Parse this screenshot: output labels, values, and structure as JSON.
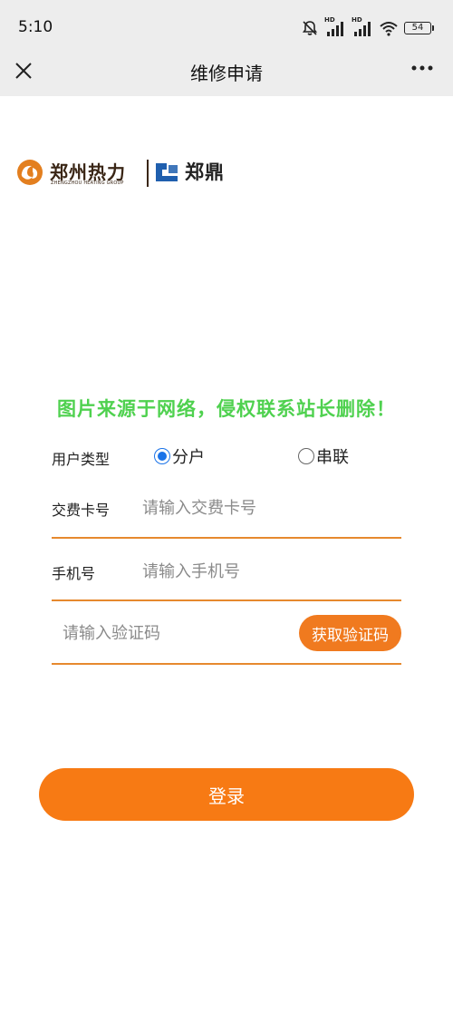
{
  "status_bar": {
    "time": "5:10",
    "hd_label": "HD",
    "battery": "54",
    "icons": [
      "bell-muted-icon",
      "hd-signal-icon",
      "hd-signal-icon",
      "wifi-icon",
      "battery-icon"
    ]
  },
  "nav": {
    "title": "维修申请",
    "close_icon": "close-icon",
    "more_icon": "more-icon"
  },
  "logo": {
    "zz_name": "郑州热力",
    "zz_english": "ZHENGZHOU HEATING GROUP",
    "zd_name": "郑鼎"
  },
  "watermark": "图片来源于网络，侵权联系站长删除！",
  "form": {
    "user_type_label": "用户类型",
    "options": [
      {
        "label": "分户",
        "checked": true
      },
      {
        "label": "串联",
        "checked": false
      }
    ],
    "card_label": "交费卡号",
    "card_placeholder": "请输入交费卡号",
    "phone_label": "手机号",
    "phone_placeholder": "请输入手机号",
    "code_placeholder": "请输入验证码",
    "get_code_button": "获取验证码"
  },
  "login_button": "登录",
  "colors": {
    "accent": "#f77a14",
    "underline": "#e6892e",
    "radio_checked": "#1a73e8",
    "watermark": "#4fd14f",
    "bar_bg": "#ededed"
  }
}
